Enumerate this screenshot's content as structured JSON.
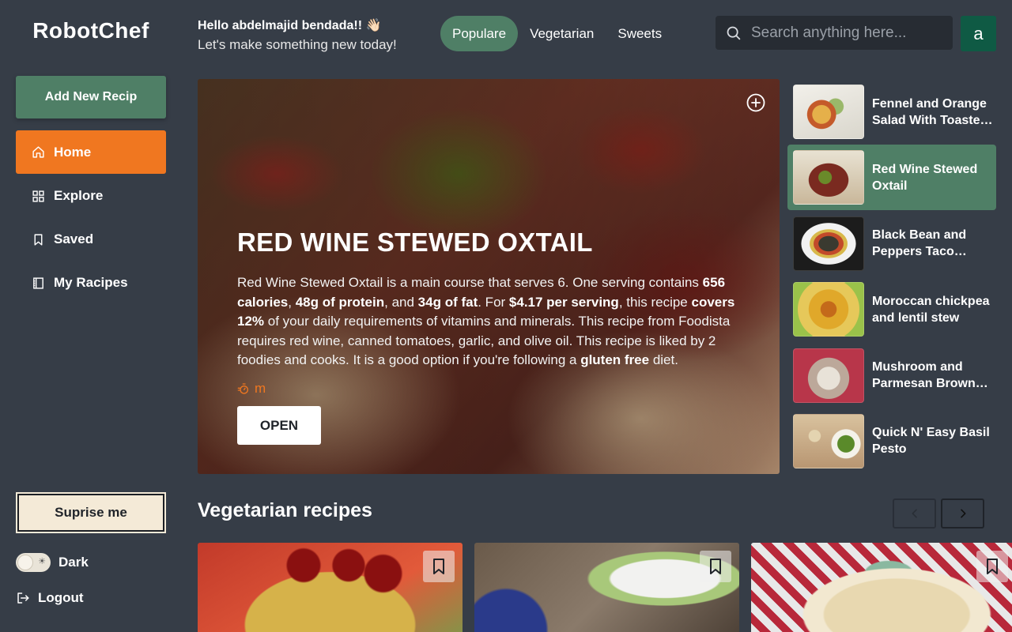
{
  "app": {
    "brand": "RobotChef"
  },
  "sidebar": {
    "add_button": "Add New Recip",
    "items": [
      {
        "label": "Home",
        "icon": "home-icon",
        "active": true
      },
      {
        "label": "Explore",
        "icon": "grid-icon",
        "active": false
      },
      {
        "label": "Saved",
        "icon": "bookmark-icon",
        "active": false
      },
      {
        "label": "My Racipes",
        "icon": "book-icon",
        "active": false
      }
    ],
    "surprise_button": "Suprise me",
    "theme_label": "Dark",
    "logout_label": "Logout"
  },
  "header": {
    "greeting": "Hello abdelmajid bendada!! 👋🏻",
    "subtitle": "Let's make something new today!",
    "tabs": [
      {
        "label": "Populare",
        "active": true
      },
      {
        "label": "Vegetarian",
        "active": false
      },
      {
        "label": "Sweets",
        "active": false
      }
    ],
    "search_placeholder": "Search anything here...",
    "avatar_letter": "a"
  },
  "hero": {
    "title": "RED WINE STEWED OXTAIL",
    "desc": {
      "t1": "Red Wine Stewed Oxtail is a main course that serves 6. One serving contains ",
      "b1": "656 calories",
      "t2": ", ",
      "b2": "48g of protein",
      "t3": ", and ",
      "b3": "34g of fat",
      "t4": ". For ",
      "b4": "$4.17 per serving",
      "t5": ", this recipe ",
      "b5": "covers 12%",
      "t6": " of your daily requirements of vitamins and minerals. This recipe from Foodista requires red wine, canned tomatoes, garlic, and olive oil. This recipe is liked by 2 foodies and cooks. It is a good option if you're following a ",
      "b6": "gluten free",
      "t7": " diet."
    },
    "time": "m",
    "open_button": "OPEN"
  },
  "popular_list": [
    {
      "label": "Fennel and Orange Salad With Toasted Pistachios",
      "active": false
    },
    {
      "label": "Red Wine Stewed Oxtail",
      "active": true
    },
    {
      "label": "Black Bean and Peppers Taco Filling",
      "active": false
    },
    {
      "label": "Moroccan chickpea and lentil stew",
      "active": false
    },
    {
      "label": "Mushroom and Parmesan Brown Rice",
      "active": false
    },
    {
      "label": "Quick N' Easy Basil Pesto",
      "active": false
    }
  ],
  "vegetarian": {
    "title": "Vegetarian recipes"
  },
  "colors": {
    "background": "#363d47",
    "accent_green": "#4f7f66",
    "accent_orange": "#f07720",
    "avatar": "#0f5a44"
  }
}
